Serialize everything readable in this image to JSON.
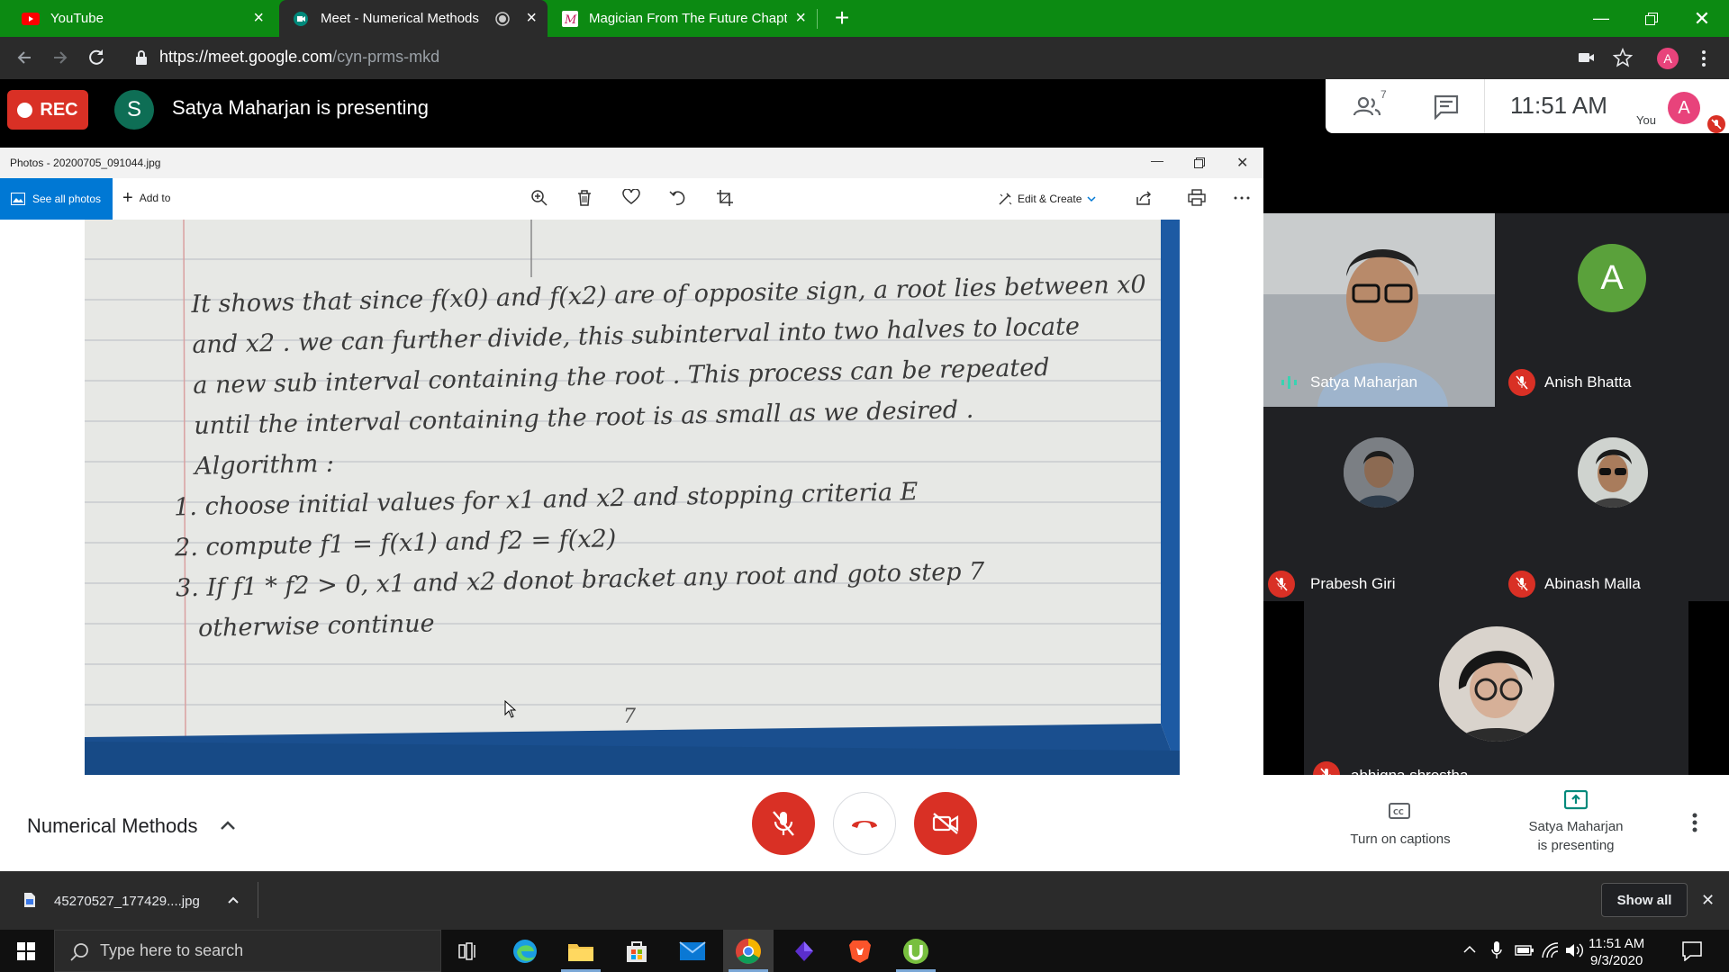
{
  "browser": {
    "tabs": [
      {
        "title": "YouTube"
      },
      {
        "title": "Meet - Numerical Methods"
      },
      {
        "title": "Magician From The Future Chapt"
      }
    ],
    "url_host": "https://meet.google.com",
    "url_path": "/cyn-prms-mkd",
    "profile_initial": "A"
  },
  "meet_header": {
    "rec_label": "REC",
    "presenter_initial": "S",
    "presenting_text": "Satya Maharjan is presenting",
    "people_count": "7",
    "time": "11:51 AM",
    "you_label": "You",
    "you_initial": "A"
  },
  "photos": {
    "window_title": "Photos - 20200705_091044.jpg",
    "see_all": "See all photos",
    "add_to": "Add to",
    "edit_create": "Edit & Create",
    "note_lines": [
      "It shows that since f(x0) and f(x2) are of opposite sign, a root lies between x0",
      "and x2 . we can further divide, this subinterval into two halves to locate",
      "a new sub interval containing the root . This process can be repeated",
      "until the interval containing the root is as small as we desired .",
      "Algorithm :",
      "1. choose initial values for x1 and x2 and stopping criteria E",
      "2. compute f1 = f(x1) and f2 = f(x2)",
      "3. If f1 * f2 > 0, x1 and x2 donot bracket any root and goto step 7",
      "otherwise continue"
    ],
    "note_mark": "7"
  },
  "participants": [
    {
      "name": "Satya Maharjan"
    },
    {
      "name": "Anish Bhatta",
      "initial": "A"
    },
    {
      "name": "Prabesh Giri"
    },
    {
      "name": "Abinash Malla"
    },
    {
      "name": "abhigna shrestha"
    }
  ],
  "bottom_bar": {
    "meeting_name": "Numerical Methods",
    "captions_label": "Turn on captions",
    "presenting_line1": "Satya Maharjan",
    "presenting_line2": "is presenting"
  },
  "downloads": {
    "file_name": "45270527_177429....jpg",
    "show_all": "Show all"
  },
  "taskbar": {
    "search_placeholder": "Type here to search",
    "time": "11:51 AM",
    "date": "9/3/2020"
  },
  "colors": {
    "tab_strip": "#0c8a12",
    "meet_red": "#d93025",
    "windows_accent": "#0078d4",
    "anish_avatar": "#5aa13b"
  }
}
